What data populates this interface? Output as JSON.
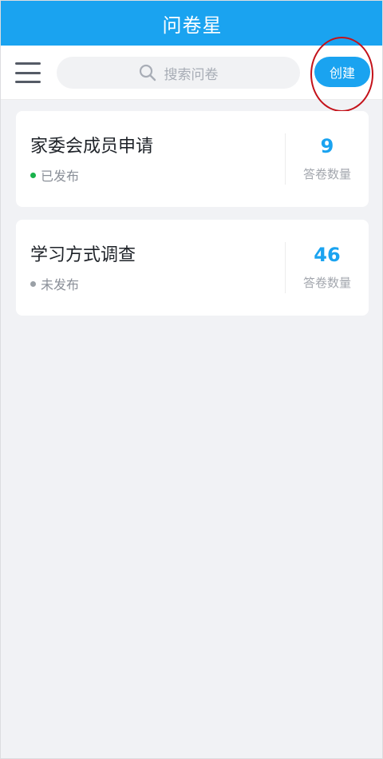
{
  "app": {
    "title": "问卷星"
  },
  "toolbar": {
    "menu_icon": "hamburger-menu-icon",
    "search_placeholder": "搜索问卷",
    "search_icon": "search-icon",
    "create_label": "创建"
  },
  "colors": {
    "primary": "#1aa3f0",
    "published_dot": "#19b24b",
    "unpublished_dot": "#9aa0a6",
    "annotation_ring": "#c4121a"
  },
  "surveys": [
    {
      "title": "家委会成员申请",
      "status": "已发布",
      "published": true,
      "count": "9",
      "count_label": "答卷数量"
    },
    {
      "title": "学习方式调查",
      "status": "未发布",
      "published": false,
      "count": "46",
      "count_label": "答卷数量"
    }
  ]
}
